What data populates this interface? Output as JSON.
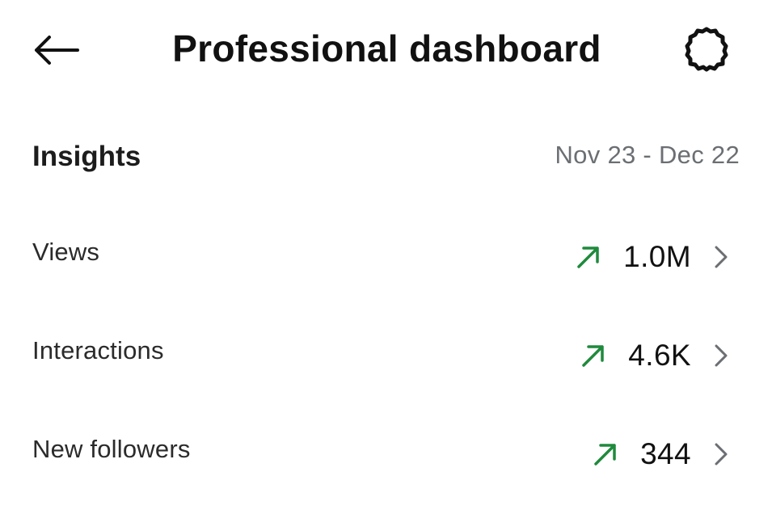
{
  "header": {
    "title": "Professional dashboard",
    "back_icon": "arrow-left-icon",
    "settings_icon": "gear-icon"
  },
  "insights": {
    "title": "Insights",
    "date_range": "Nov 23 - Dec 22",
    "rows": [
      {
        "label": "Views",
        "value": "1.0M",
        "trend": "up"
      },
      {
        "label": "Interactions",
        "value": "4.6K",
        "trend": "up"
      },
      {
        "label": "New followers",
        "value": "344",
        "trend": "up"
      }
    ]
  },
  "colors": {
    "trend_up": "#1f8a3c",
    "muted_text": "#6b6f73",
    "chevron": "#6b6f73"
  }
}
